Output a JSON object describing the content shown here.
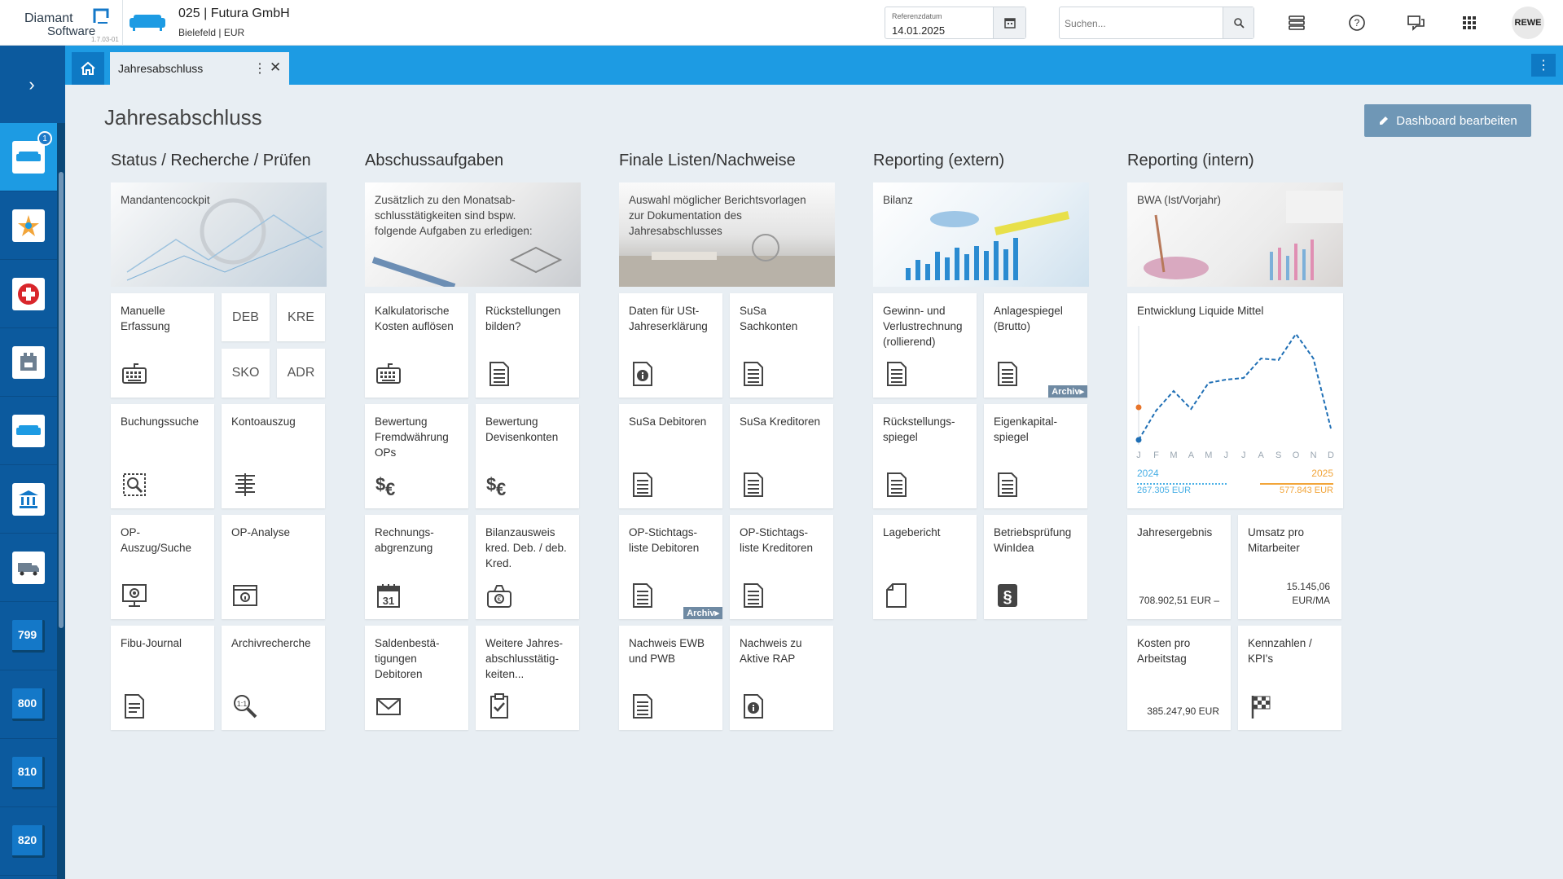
{
  "app": {
    "logo_line1": "Diamant",
    "logo_line2": "Software",
    "version": "1.7.03-01",
    "company_name": "025 | Futura GmbH",
    "company_sub": "Bielefeld | EUR"
  },
  "header": {
    "refdate_label": "Referenzdatum",
    "refdate_value": "14.01.2025",
    "search_placeholder": "Suchen...",
    "user": "REWE"
  },
  "sidebar": {
    "badge": "1",
    "numbers": [
      "799",
      "800",
      "810",
      "820"
    ]
  },
  "tab": {
    "label": "Jahresabschluss"
  },
  "page": {
    "title": "Jahresabschluss",
    "edit_button": "Dashboard bearbeiten"
  },
  "columns": [
    "Status / Recherche / Prüfen",
    "Abschussaufgaben",
    "Finale Listen/Nachweise",
    "Reporting (extern)",
    "Reporting (intern)"
  ],
  "banners": [
    "Mandantencockpit",
    "Zusätzlich zu den Monatsab-\nschlusstätigkeiten sind bspw.\nfolgende Aufgaben zu erledigen:",
    "Auswahl möglicher Berichtsvorlagen\nzur Dokumentation des\nJahresabschlusses",
    "Bilanz",
    "BWA (Ist/Vorjahr)"
  ],
  "tiles": {
    "c1": {
      "manual": "Manuelle\nErfassung",
      "deb": "DEB",
      "kre": "KRE",
      "sko": "SKO",
      "adr": "ADR",
      "buchungssuche": "Buchungssuche",
      "kontoauszug": "Kontoauszug",
      "op_auszug": "OP-\nAuszug/Suche",
      "op_analyse": "OP-Analyse",
      "fibu": "Fibu-Journal",
      "archiv": "Archivrecherche"
    },
    "c2": {
      "kalk": "Kalkulatorische\nKosten auflösen",
      "rueck": "Rückstellungen\nbilden?",
      "fremd": "Bewertung\nFremdwährung\nOPs",
      "devisen": "Bewertung\nDevisenkonten",
      "abgr": "Rechnungs-\nabgrenzung",
      "bilaus": "Bilanzausweis\nkred. Deb. / deb.\nKred.",
      "salden": "Saldenbestä-\ntigungen\nDebitoren",
      "weitere": "Weitere Jahres-\nabschlusstätig-\nkeiten..."
    },
    "c3": {
      "ust": "Daten für USt-\nJahreserklärung",
      "susa_sach": "SuSa\nSachkonten",
      "susa_deb": "SuSa Debitoren",
      "susa_kred": "SuSa Kreditoren",
      "op_deb": "OP-Stichtags-\nliste Debitoren",
      "op_kred": "OP-Stichtags-\nliste Kreditoren",
      "ewb": "Nachweis EWB\nund PWB",
      "rap": "Nachweis zu\nAktive RAP"
    },
    "c4": {
      "guv": "Gewinn- und\nVerlustrechnung\n(rollierend)",
      "anlage": "Anlagespiegel\n(Brutto)",
      "rueckspiegel": "Rückstellungs-\nspiegel",
      "eigenkap": "Eigenkapital-\nspiegel",
      "lage": "Lagebericht",
      "betrieb": "Betriebsprüfung\nWinIdea"
    },
    "c5": {
      "liquide": "Entwicklung Liquide Mittel",
      "jahres": "Jahresergebnis",
      "jahres_val": "708.902,51  EUR –",
      "umsatz": "Umsatz pro\nMitarbeiter",
      "umsatz_val": "15.145,06\nEUR/MA",
      "kosten": "Kosten pro\nArbeitstag",
      "kosten_val": "385.247,90  EUR",
      "kennzahlen": "Kennzahlen /\nKPI's"
    },
    "archiv_badge": "Archiv▸"
  },
  "chart_data": {
    "type": "line",
    "title": "Entwicklung Liquide Mittel",
    "categories": [
      "J",
      "F",
      "M",
      "A",
      "M",
      "J",
      "J",
      "A",
      "S",
      "O",
      "N",
      "D"
    ],
    "series": [
      {
        "name": "2024",
        "values": [
          0.0,
          0.18,
          0.3,
          0.19,
          0.35,
          0.37,
          0.38,
          0.5,
          0.49,
          0.65,
          0.5,
          0.07
        ],
        "color": "#1f6fb5"
      },
      {
        "name": "2025",
        "values": [
          0.2
        ],
        "color": "#e8742a"
      }
    ],
    "legend": [
      {
        "year": "2024",
        "value": "267.305 EUR",
        "color": "#4ab0e6"
      },
      {
        "year": "2025",
        "value": "577.843 EUR",
        "color": "#f2a53a"
      }
    ]
  },
  "colors": {
    "sidebar": "#0c5a9e",
    "tabbar": "#1d9be3",
    "edit_button": "#6f97b6"
  }
}
